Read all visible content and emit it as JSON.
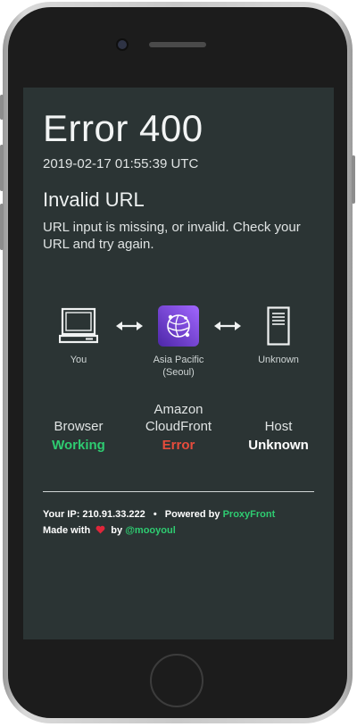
{
  "error": {
    "title": "Error 400",
    "timestamp": "2019-02-17 01:55:39 UTC",
    "reason": "Invalid URL",
    "description": "URL input is missing, or invalid. Check your URL and try again."
  },
  "nodes": {
    "you": {
      "label": "You",
      "icon": "laptop-icon"
    },
    "edge": {
      "label_line1": "Asia Pacific",
      "label_line2": "(Seoul)",
      "icon": "cloudfront-icon"
    },
    "host": {
      "label": "Unknown",
      "icon": "server-icon"
    }
  },
  "statuses": {
    "browser": {
      "name": "Browser",
      "state": "Working",
      "color": "#2ecc71"
    },
    "cloudfront": {
      "name_line1": "Amazon",
      "name_line2": "CloudFront",
      "state": "Error",
      "color": "#e74c3c"
    },
    "host": {
      "name": "Host",
      "state": "Unknown",
      "color": "#ffffff"
    }
  },
  "footer": {
    "ip_label": "Your IP:",
    "ip_value": "210.91.33.222",
    "separator": "•",
    "powered_label": "Powered by",
    "powered_link": "ProxyFront",
    "made_with": "Made with",
    "heart_icon": "heart-icon",
    "by_label": "by",
    "author_link": "@mooyoul"
  },
  "colors": {
    "background": "#2b3434",
    "accent_green": "#2ecc71",
    "error_red": "#e74c3c",
    "cloudfront_purple": "#7b46d6"
  }
}
